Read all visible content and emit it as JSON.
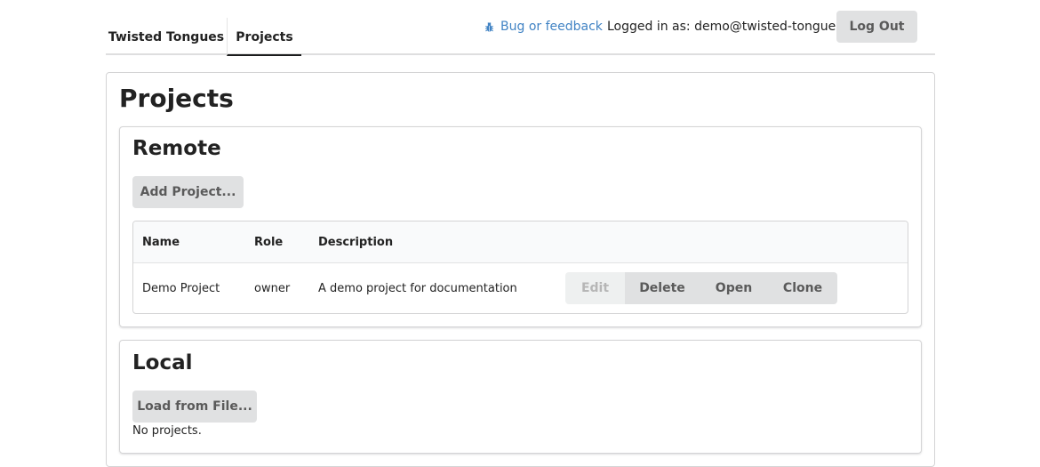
{
  "nav": {
    "brand": "Twisted Tongues",
    "active_tab": "Projects",
    "feedback_label": "Bug or feedback",
    "feedback_icon": "bug-icon",
    "login_text": "Logged in as: demo@twisted-tongues.com",
    "logout_label": "Log Out"
  },
  "colors": {
    "link": "#4183c4",
    "button_bg": "#e0e1e2",
    "button_text": "#5a5a5a",
    "disabled_bg": "#eef0f0",
    "disabled_text": "#b6b6b6"
  },
  "page": {
    "title": "Projects"
  },
  "remote": {
    "title": "Remote",
    "add_label": "Add Project...",
    "columns": [
      "Name",
      "Role",
      "Description"
    ],
    "rows": [
      {
        "name": "Demo Project",
        "role": "owner",
        "description": "A demo project for documentation",
        "actions": {
          "edit": "Edit",
          "delete": "Delete",
          "open": "Open",
          "clone": "Clone"
        }
      }
    ]
  },
  "local": {
    "title": "Local",
    "load_label": "Load from File...",
    "empty_text": "No projects."
  }
}
